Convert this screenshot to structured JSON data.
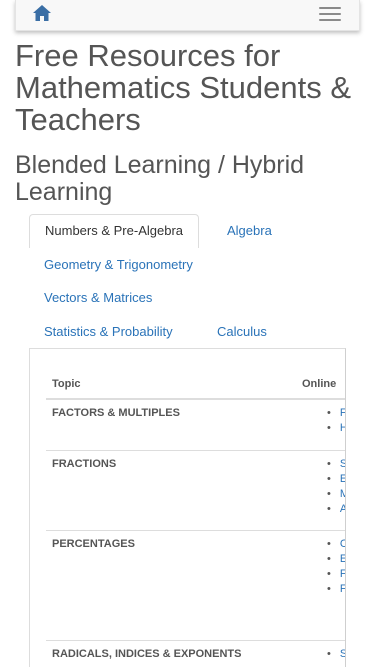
{
  "navbar": {
    "home_icon": "home-icon",
    "menu_icon": "hamburger-menu-icon"
  },
  "page": {
    "title": "Free Resources for Mathematics Students & Teachers",
    "subtitle": "Blended Learning / Hybrid Learning"
  },
  "tabs": [
    {
      "label": "Numbers & Pre-Algebra",
      "active": true
    },
    {
      "label": "Algebra",
      "active": false
    },
    {
      "label": "Geometry & Trigonometry",
      "active": false
    },
    {
      "label": "Vectors & Matrices",
      "active": false
    },
    {
      "label": "Statistics & Probability",
      "active": false
    },
    {
      "label": "Calculus",
      "active": false
    }
  ],
  "table": {
    "headers": [
      "Topic",
      "Online"
    ],
    "rows": [
      {
        "topic": "FACTORS & MULTIPLES",
        "links": [
          "F",
          "H"
        ]
      },
      {
        "topic": "FRACTIONS",
        "links": [
          "S",
          "E",
          "M",
          "A"
        ]
      },
      {
        "topic": "PERCENTAGES",
        "links": [
          "C",
          "E",
          "F",
          "F"
        ]
      },
      {
        "topic": "RADICALS, INDICES & EXPONENTS",
        "links": [
          "S"
        ]
      }
    ]
  },
  "colors": {
    "link": "#2a73b8",
    "text": "#555555",
    "home_icon": "#3a6ea5"
  }
}
